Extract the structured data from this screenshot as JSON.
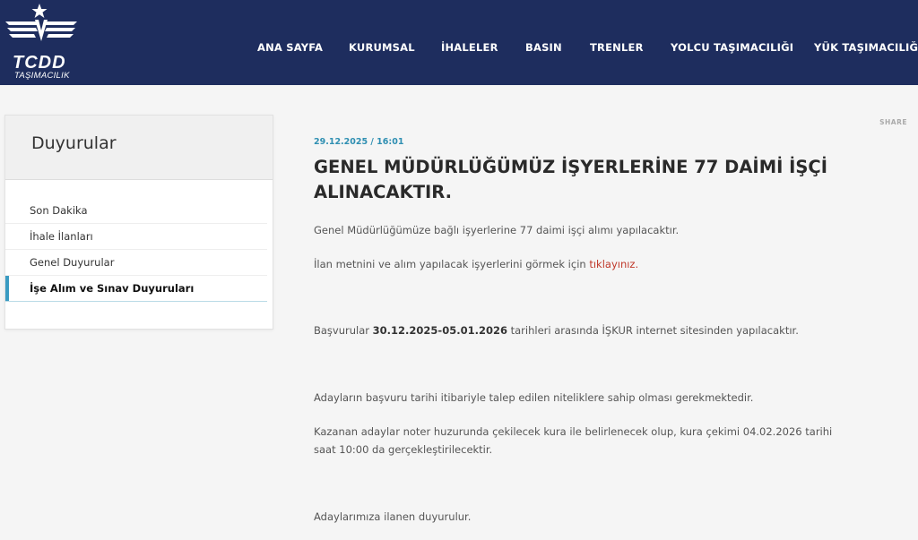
{
  "header": {
    "logo_text": "TCDD",
    "logo_sub": "TAŞIMACILIK",
    "nav": [
      "ANA SAYFA",
      "KURUMSAL",
      "İHALELER",
      "BASIN",
      "TRENLER",
      "YOLCU TAŞIMACILIĞI",
      "YÜK TAŞIMACILIĞI"
    ]
  },
  "sidebar": {
    "title": "Duyurular",
    "items": [
      "Son Dakika",
      "İhale İlanları",
      "Genel Duyurular",
      "İşe Alım ve Sınav Duyuruları"
    ],
    "active": "İşe Alım ve Sınav Duyuruları"
  },
  "article": {
    "share": "SHARE",
    "date": "29.12.2025 / 16:01",
    "title": "GENEL MÜDÜRLÜĞÜMÜZ İŞYERLERİNE 77 DAİMİ İŞÇİ ALINACAKTIR.",
    "p1": "Genel Müdürlüğümüze bağlı işyerlerine 77 daimi işçi alımı yapılacaktır.",
    "p2_pre": "İlan metnini ve alım yapılacak işyerlerini görmek için ",
    "p2_link": "tıklayınız.",
    "p3_pre": "Başvurular ",
    "p3_bold": "30.12.2025-05.01.2026",
    "p3_post": " tarihleri arasında İŞKUR internet sitesinden yapılacaktır.",
    "p4": "Adayların başvuru tarihi itibariyle talep edilen niteliklere sahip olması gerekmektedir.",
    "p5": "Kazanan adaylar noter huzurunda çekilecek kura ile belirlenecek olup, kura çekimi 04.02.2026 tarihi saat 10:00 da gerçekleştirilecektir.",
    "p6": "Adaylarımıza ilanen duyurulur."
  }
}
